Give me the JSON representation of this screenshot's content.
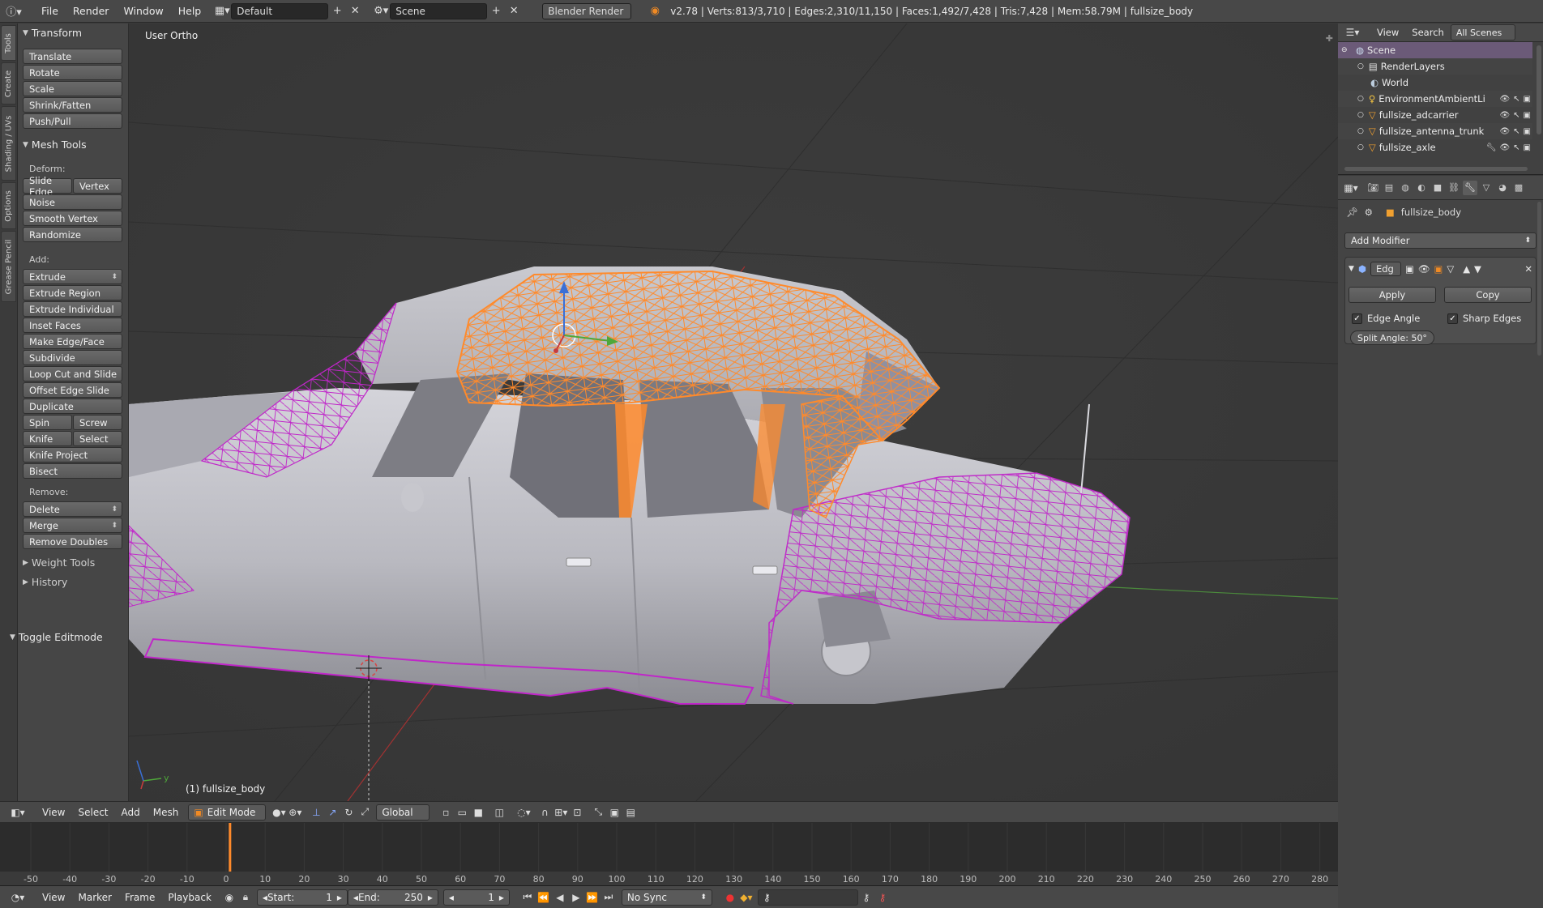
{
  "topbar": {
    "menus": [
      "File",
      "Render",
      "Window",
      "Help"
    ],
    "layout": "Default",
    "scene": "Scene",
    "engine": "Blender Render",
    "stats": "v2.78 | Verts:813/3,710 | Edges:2,310/11,150 | Faces:1,492/7,428 | Tris:7,428 | Mem:58.79M | fullsize_body"
  },
  "toolshelf": {
    "tabs": [
      "Tools",
      "Create",
      "Shading / UVs",
      "Options",
      "Grease Pencil"
    ],
    "transform": {
      "title": "Transform",
      "buttons": [
        "Translate",
        "Rotate",
        "Scale",
        "Shrink/Fatten",
        "Push/Pull"
      ]
    },
    "mesh_tools": {
      "title": "Mesh Tools",
      "deform_label": "Deform:",
      "slide_edge": "Slide Edge",
      "vertex": "Vertex",
      "noise": "Noise",
      "smooth_vertex": "Smooth Vertex",
      "randomize": "Randomize",
      "add_label": "Add:",
      "extrude": "Extrude",
      "extrude_region": "Extrude Region",
      "extrude_individual": "Extrude Individual",
      "inset_faces": "Inset Faces",
      "make_edge_face": "Make Edge/Face",
      "subdivide": "Subdivide",
      "loop_cut": "Loop Cut and Slide",
      "offset_edge": "Offset Edge Slide",
      "duplicate": "Duplicate",
      "spin": "Spin",
      "screw": "Screw",
      "knife": "Knife",
      "select": "Select",
      "knife_project": "Knife Project",
      "bisect": "Bisect",
      "remove_label": "Remove:",
      "delete": "Delete",
      "merge": "Merge",
      "remove_doubles": "Remove Doubles"
    },
    "weight_tools": "Weight Tools",
    "history": "History",
    "toggle_editmode": "Toggle Editmode"
  },
  "viewport": {
    "view_label": "User Ortho",
    "object_label": "(1) fullsize_body",
    "axis_y": "y"
  },
  "view3d_header": {
    "menus": [
      "View",
      "Select",
      "Add",
      "Mesh"
    ],
    "mode": "Edit Mode",
    "orientation": "Global"
  },
  "timeline": {
    "ticks": [
      -50,
      -40,
      -30,
      -20,
      -10,
      0,
      10,
      20,
      30,
      40,
      50,
      60,
      70,
      80,
      90,
      100,
      110,
      120,
      130,
      140,
      150,
      160,
      170,
      180,
      190,
      200,
      210,
      220,
      230,
      240,
      250,
      260,
      270,
      280
    ],
    "current_frame": 1,
    "menus": [
      "View",
      "Marker",
      "Frame",
      "Playback"
    ],
    "start_label": "Start:",
    "start": "1",
    "end_label": "End:",
    "end": "250",
    "frame": "1",
    "sync": "No Sync"
  },
  "outliner": {
    "header_view": "View",
    "header_search": "Search",
    "header_scope": "All Scenes",
    "items": [
      {
        "label": "Scene",
        "selected": true
      },
      {
        "label": "RenderLayers"
      },
      {
        "label": "World"
      },
      {
        "label": "EnvironmentAmbientLi"
      },
      {
        "label": "fullsize_adcarrier"
      },
      {
        "label": "fullsize_antenna_trunk"
      },
      {
        "label": "fullsize_axle"
      }
    ]
  },
  "properties": {
    "object_name": "fullsize_body",
    "add_modifier": "Add Modifier",
    "modifier_name": "Edg",
    "apply": "Apply",
    "copy": "Copy",
    "edge_angle": "Edge Angle",
    "sharp_edges": "Sharp Edges",
    "split_angle": "Split Angle: 50°"
  },
  "colors": {
    "wire_selected": "#ff8a2b",
    "wire_unselected": "#c026c9",
    "axis_x": "#c83c3c",
    "axis_y": "#4fa83a",
    "axis_z": "#3a6fd6",
    "playhead": "#ff8a2b"
  }
}
